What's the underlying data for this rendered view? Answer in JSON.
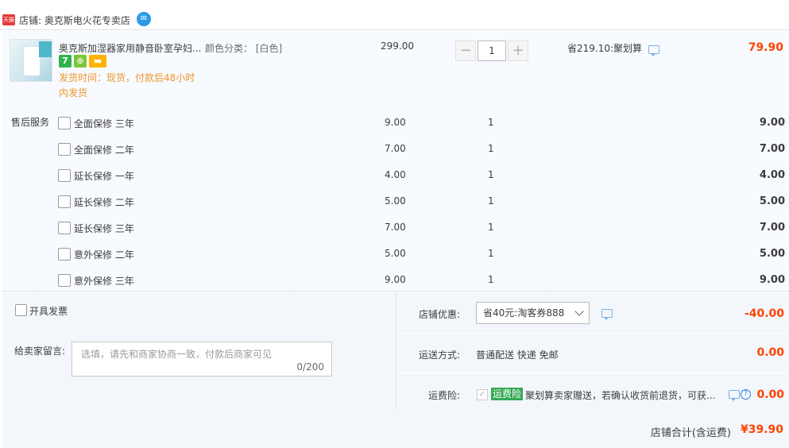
{
  "shop": {
    "badge": "天猫",
    "name": "店铺: 奥克斯电火花专卖店"
  },
  "item": {
    "title": "奥克斯加湿器家用静音卧室孕妇...",
    "ship_time": "发货时间：现货，付款后48小时内发货",
    "sku": "颜色分类： [白色]",
    "unit_price": "299.00",
    "quantity": "1",
    "qty_minus": "−",
    "qty_plus": "+",
    "savings": "省219.10:聚划算",
    "total": "79.90",
    "badge_7": "7"
  },
  "services": {
    "label": "售后服务",
    "rows": [
      {
        "name": "全面保修 三年",
        "price": "9.00",
        "qty": "1",
        "total": "9.00"
      },
      {
        "name": "全面保修 二年",
        "price": "7.00",
        "qty": "1",
        "total": "7.00"
      },
      {
        "name": "延长保修 一年",
        "price": "4.00",
        "qty": "1",
        "total": "4.00"
      },
      {
        "name": "延长保修 二年",
        "price": "5.00",
        "qty": "1",
        "total": "5.00"
      },
      {
        "name": "延长保修 三年",
        "price": "7.00",
        "qty": "1",
        "total": "7.00"
      },
      {
        "name": "意外保修 二年",
        "price": "5.00",
        "qty": "1",
        "total": "5.00"
      },
      {
        "name": "意外保修 三年",
        "price": "9.00",
        "qty": "1",
        "total": "9.00"
      }
    ]
  },
  "invoice": {
    "label": "开具发票"
  },
  "message": {
    "label": "给卖家留言:",
    "placeholder": "选填，请先和商家协商一致，付款后商家可见",
    "count": "0/200"
  },
  "coupon": {
    "label": "店铺优惠:",
    "selected": "省40元:淘客券888",
    "amount": "-40.00"
  },
  "shipping": {
    "label": "运送方式:",
    "value": "普通配送 快递 免邮",
    "amount": "0.00"
  },
  "insurance": {
    "label": "运费险:",
    "tag": "运费险",
    "desc": "聚划算卖家赠送，若确认收货前退货，可获...",
    "amount": "0.00"
  },
  "summary": {
    "label": "店铺合计(含运费)",
    "total": "¥39.90"
  },
  "colors": {
    "accent_price": "#ff4400",
    "ship_time": "#f0952a",
    "panel_bg": "#f3f7fc"
  }
}
